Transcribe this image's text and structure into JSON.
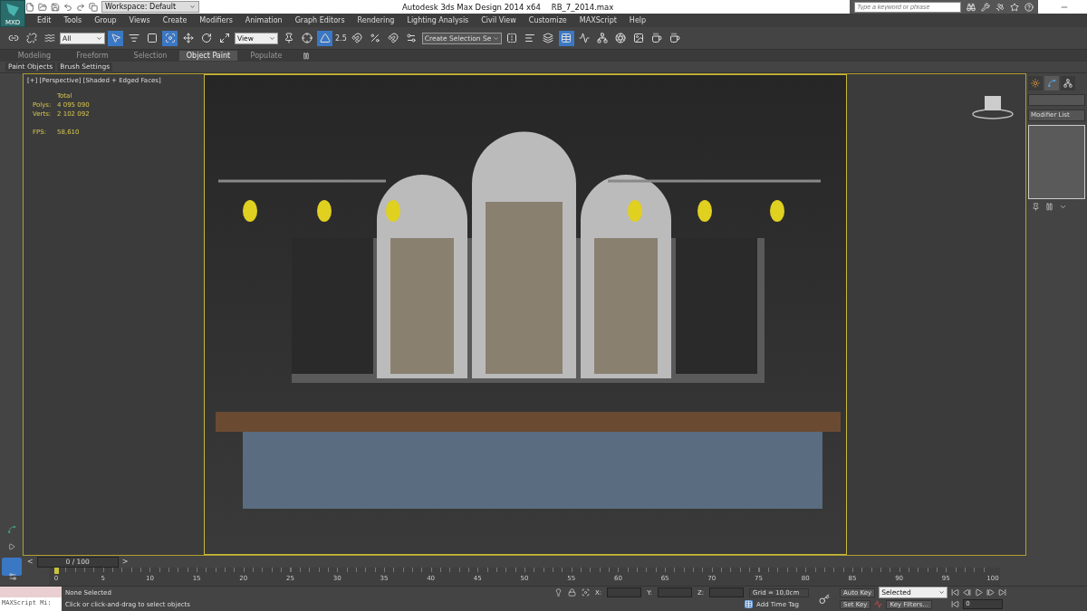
{
  "window": {
    "title": "Autodesk 3ds Max Design 2014 x64",
    "file": "RB_7_2014.max"
  },
  "app_button": "MXD",
  "workspace": "Workspace: Default",
  "search": {
    "placeholder": "Type a keyword or phrase"
  },
  "menu": [
    "Edit",
    "Tools",
    "Group",
    "Views",
    "Create",
    "Modifiers",
    "Animation",
    "Graph Editors",
    "Rendering",
    "Lighting Analysis",
    "Civil View",
    "Customize",
    "MAXScript",
    "Help"
  ],
  "toolbar": {
    "selection_filter": "All",
    "reference_coord": "View",
    "snap_value": "2.5",
    "named_selection": "Create Selection Se"
  },
  "ribbon_tabs": [
    {
      "label": "Modeling",
      "selected": false
    },
    {
      "label": "Freeform",
      "selected": false
    },
    {
      "label": "Selection",
      "selected": false
    },
    {
      "label": "Object Paint",
      "selected": true
    },
    {
      "label": "Populate",
      "selected": false
    }
  ],
  "ribbon_panels": [
    "Paint Objects",
    "Brush Settings"
  ],
  "viewport": {
    "label": "[+] [Perspective] [Shaded + Edged Faces]",
    "stats_header": "Total",
    "stats": [
      {
        "label": "Polys:",
        "value": "4 095 090"
      },
      {
        "label": "Verts:",
        "value": "2 102 092"
      }
    ],
    "fps_label": "FPS:",
    "fps": "58,610"
  },
  "command_panel": {
    "modifier_list": "Modifier List"
  },
  "timeline": {
    "frame": "0 / 100",
    "level": 0,
    "prev": "<",
    "next": ">",
    "ticks": [
      "0",
      "5",
      "10",
      "15",
      "20",
      "25",
      "30",
      "35",
      "40",
      "45",
      "50",
      "55",
      "60",
      "65",
      "70",
      "75",
      "80",
      "85",
      "90",
      "95",
      "100"
    ]
  },
  "status": {
    "maxscript": "MAXScript Mi:",
    "selection": "None Selected",
    "prompt": "Click or click-and-drag to select objects",
    "x_label": "X:",
    "y_label": "Y:",
    "z_label": "Z:",
    "grid": "Grid = 10,0cm",
    "add_time_tag": "Add Time Tag",
    "auto_key": "Auto Key",
    "key_mode": "Selected",
    "set_key": "Set Key",
    "key_filters": "Key Filters...",
    "current_frame": "0"
  }
}
